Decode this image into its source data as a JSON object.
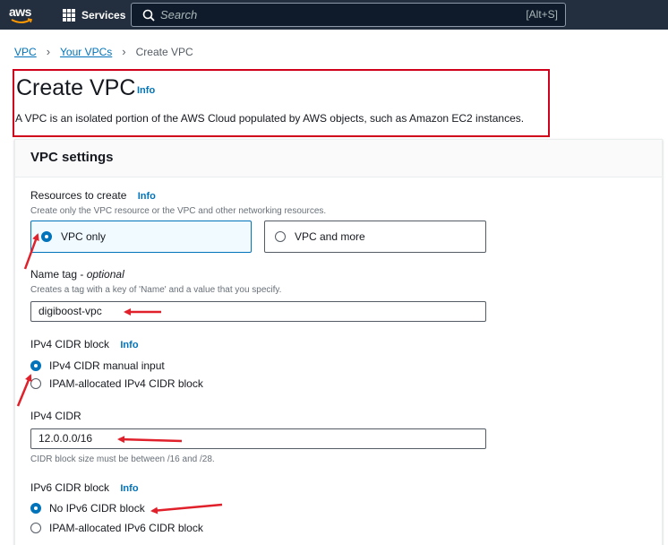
{
  "nav": {
    "logo_text": "aws",
    "services_label": "Services",
    "search_placeholder": "Search",
    "search_shortcut": "[Alt+S]"
  },
  "breadcrumb": {
    "items": [
      "VPC",
      "Your VPCs"
    ],
    "current": "Create VPC"
  },
  "header": {
    "title": "Create VPC",
    "info": "Info",
    "description": "A VPC is an isolated portion of the AWS Cloud populated by AWS objects, such as Amazon EC2 instances."
  },
  "settings": {
    "title": "VPC settings",
    "resources": {
      "label": "Resources to create",
      "info": "Info",
      "hint": "Create only the VPC resource or the VPC and other networking resources.",
      "options": [
        "VPC only",
        "VPC and more"
      ],
      "selected": "VPC only"
    },
    "name_tag": {
      "label": "Name tag - ",
      "label_optional": "optional",
      "hint": "Creates a tag with a key of 'Name' and a value that you specify.",
      "value": "digiboost-vpc"
    },
    "ipv4_block": {
      "label": "IPv4 CIDR block",
      "info": "Info",
      "options": [
        "IPv4 CIDR manual input",
        "IPAM-allocated IPv4 CIDR block"
      ],
      "selected": "IPv4 CIDR manual input"
    },
    "ipv4_cidr": {
      "label": "IPv4 CIDR",
      "value": "12.0.0.0/16",
      "hint": "CIDR block size must be between /16 and /28."
    },
    "ipv6_block": {
      "label": "IPv6 CIDR block",
      "info": "Info",
      "options": [
        "No IPv6 CIDR block",
        "IPAM-allocated IPv6 CIDR block"
      ],
      "selected": "No IPv6 CIDR block"
    }
  },
  "colors": {
    "nav_bg": "#232f3e",
    "link": "#0073bb",
    "highlight_box": "#d0021b",
    "annotation_arrow": "#e0202a"
  }
}
